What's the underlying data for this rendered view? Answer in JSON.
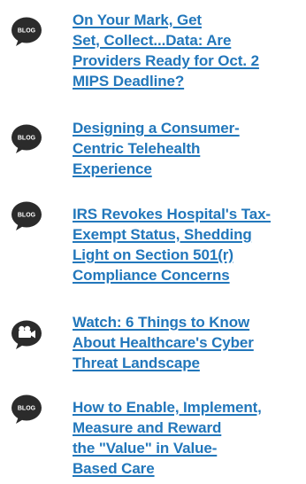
{
  "colors": {
    "link": "#2277bb",
    "icon_bubble": "#2b2b2b",
    "icon_text": "#ffffff"
  },
  "items": [
    {
      "icon": "blog-speech-bubble-icon",
      "icon_label": "BLOG",
      "title_lines": [
        "On Your Mark, Get",
        "Set, Collect...Data: Are",
        "Providers Ready for Oct. 2",
        "MIPS Deadline?"
      ]
    },
    {
      "icon": "blog-speech-bubble-icon",
      "icon_label": "BLOG",
      "title_lines": [
        "Designing a Consumer-",
        "Centric Telehealth",
        "Experience"
      ]
    },
    {
      "icon": "blog-speech-bubble-icon",
      "icon_label": "BLOG",
      "title_lines": [
        "IRS Revokes Hospital's Tax-",
        "Exempt Status, Shedding",
        "Light on Section 501(r)",
        "Compliance Concerns"
      ]
    },
    {
      "icon": "video-camera-icon",
      "icon_label": "",
      "title_lines": [
        "Watch: 6 Things to Know",
        "About Healthcare's Cyber",
        "Threat Landscape"
      ]
    },
    {
      "icon": "blog-speech-bubble-icon",
      "icon_label": "BLOG",
      "title_lines": [
        "How to Enable, Implement,",
        "Measure and Reward",
        "the \"Value\" in Value-",
        "Based Care"
      ]
    }
  ]
}
